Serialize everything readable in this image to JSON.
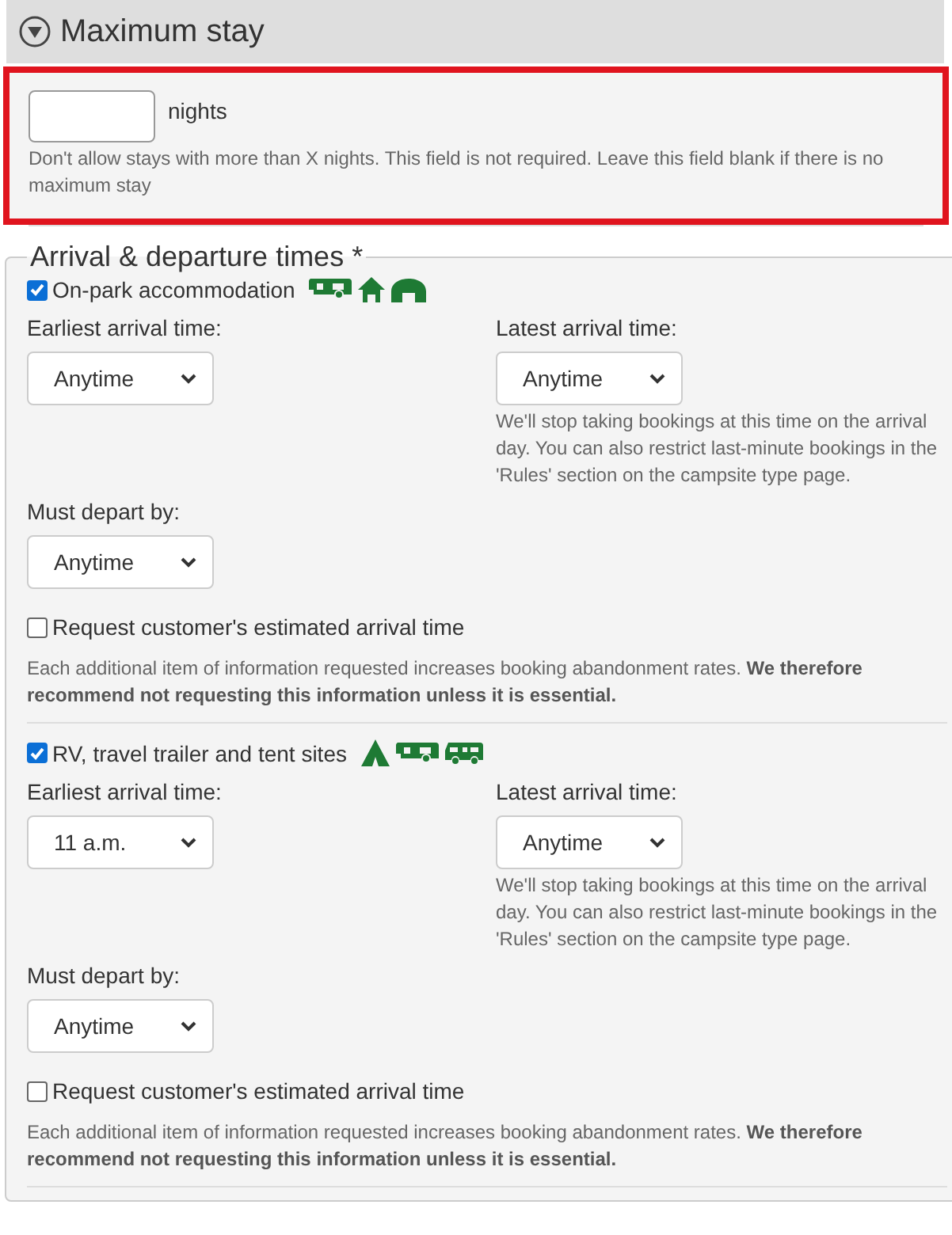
{
  "max_stay": {
    "title": "Maximum stay",
    "expanded": true,
    "input": {
      "unit": "nights",
      "hint": "Don't allow stays with more than X nights. This field is not required. Leave this field blank if there is no maximum stay"
    }
  },
  "arrival_departure": {
    "legend": "Arrival & departure times *",
    "groups": [
      {
        "label": "On-park accommodation",
        "checked": true,
        "icons": [
          {
            "kind": "caravan"
          },
          {
            "kind": "house"
          },
          {
            "kind": "hut"
          }
        ],
        "earliest_label": "Earliest arrival time:",
        "earliest_value": "Anytime",
        "latest_label": "Latest arrival time:",
        "latest_value": "Anytime",
        "latest_hint": "We'll stop taking bookings at this time on the arrival day. You can also restrict last-minute bookings in the 'Rules' section on the campsite type page.",
        "depart_label": "Must depart by:",
        "depart_value": "Anytime",
        "request_label": "Request customer's estimated arrival time",
        "request_checked": false,
        "note": "Each additional item of information requested increases booking abandonment rates. **We therefore recommend not requesting this information unless it is essential.**"
      },
      {
        "label": "RV, travel trailer and tent sites",
        "checked": true,
        "icons": [
          {
            "kind": "tent"
          },
          {
            "kind": "caravan"
          },
          {
            "kind": "motorhome"
          }
        ],
        "earliest_label": "Earliest arrival time:",
        "earliest_value": "11 a.m.",
        "latest_label": "Latest arrival time:",
        "latest_value": "Anytime",
        "latest_hint": "We'll stop taking bookings at this time on the arrival day. You can also restrict last-minute bookings in the 'Rules' section on the campsite type page.",
        "depart_label": "Must depart by:",
        "depart_value": "Anytime",
        "request_label": "Request customer's estimated arrival time",
        "request_checked": false,
        "note": "Each additional item of information requested increases booking abandonment rates. **We therefore recommend not requesting this information unless it is essential.**"
      }
    ]
  }
}
